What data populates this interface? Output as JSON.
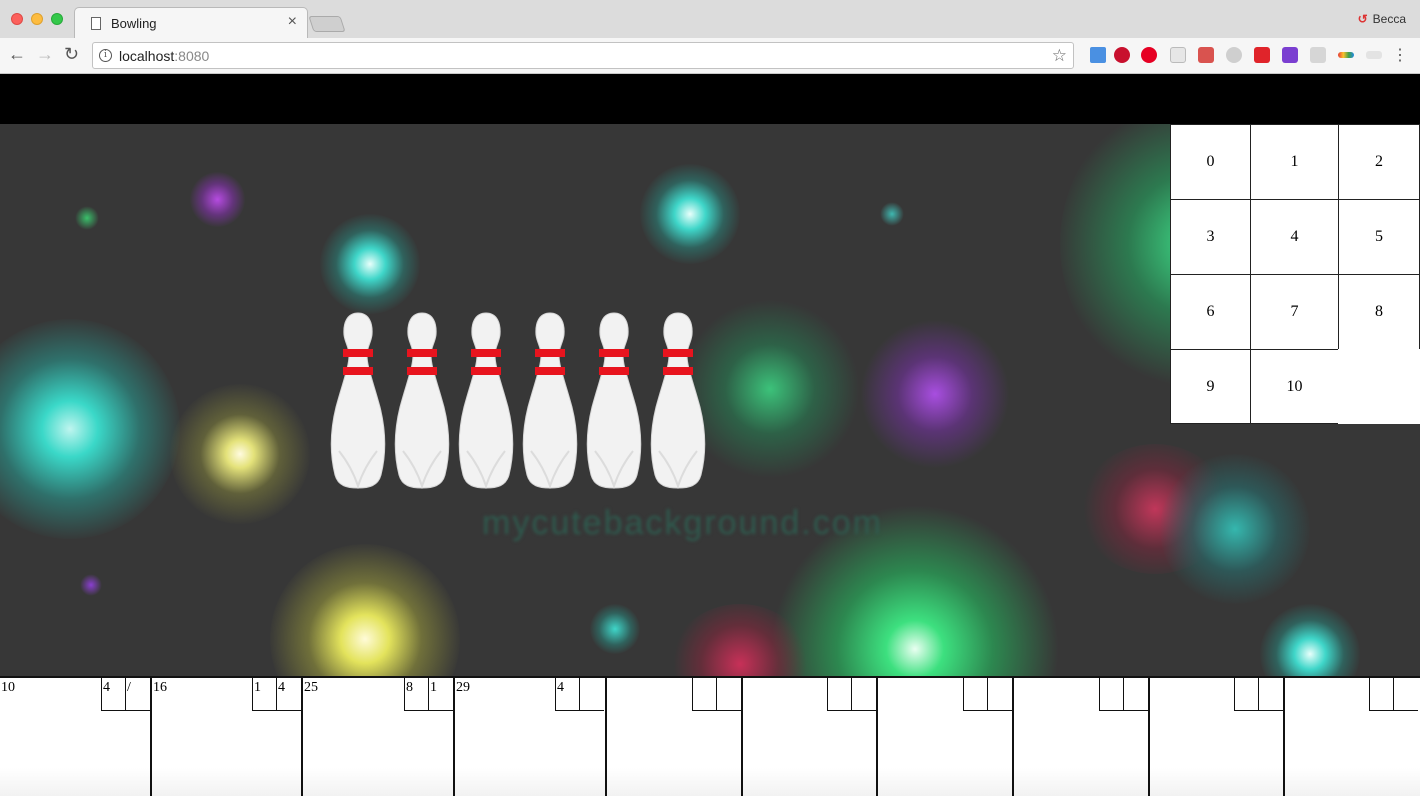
{
  "browser": {
    "tab_title": "Bowling",
    "tab_close": "×",
    "url_host": "localhost",
    "url_port": ":8080",
    "profile_name": "Becca",
    "icons": [
      "back-icon",
      "forward-icon",
      "reload-icon",
      "info-icon",
      "star-icon",
      "menu-icon"
    ]
  },
  "keypad": {
    "keys": [
      "0",
      "1",
      "2",
      "3",
      "4",
      "5",
      "6",
      "7",
      "8",
      "9",
      "10"
    ]
  },
  "pins": {
    "standing_count": 6
  },
  "scorecard": {
    "frames": [
      {
        "total": "10",
        "roll1": "4",
        "roll2": "/"
      },
      {
        "total": "16",
        "roll1": "1",
        "roll2": "4"
      },
      {
        "total": "25",
        "roll1": "8",
        "roll2": "1"
      },
      {
        "total": "29",
        "roll1": "4",
        "roll2": ""
      },
      {
        "total": "",
        "roll1": "",
        "roll2": ""
      },
      {
        "total": "",
        "roll1": "",
        "roll2": ""
      },
      {
        "total": "",
        "roll1": "",
        "roll2": ""
      },
      {
        "total": "",
        "roll1": "",
        "roll2": ""
      },
      {
        "total": "",
        "roll1": "",
        "roll2": ""
      },
      {
        "total": "",
        "roll1": "",
        "roll2": ""
      }
    ]
  }
}
